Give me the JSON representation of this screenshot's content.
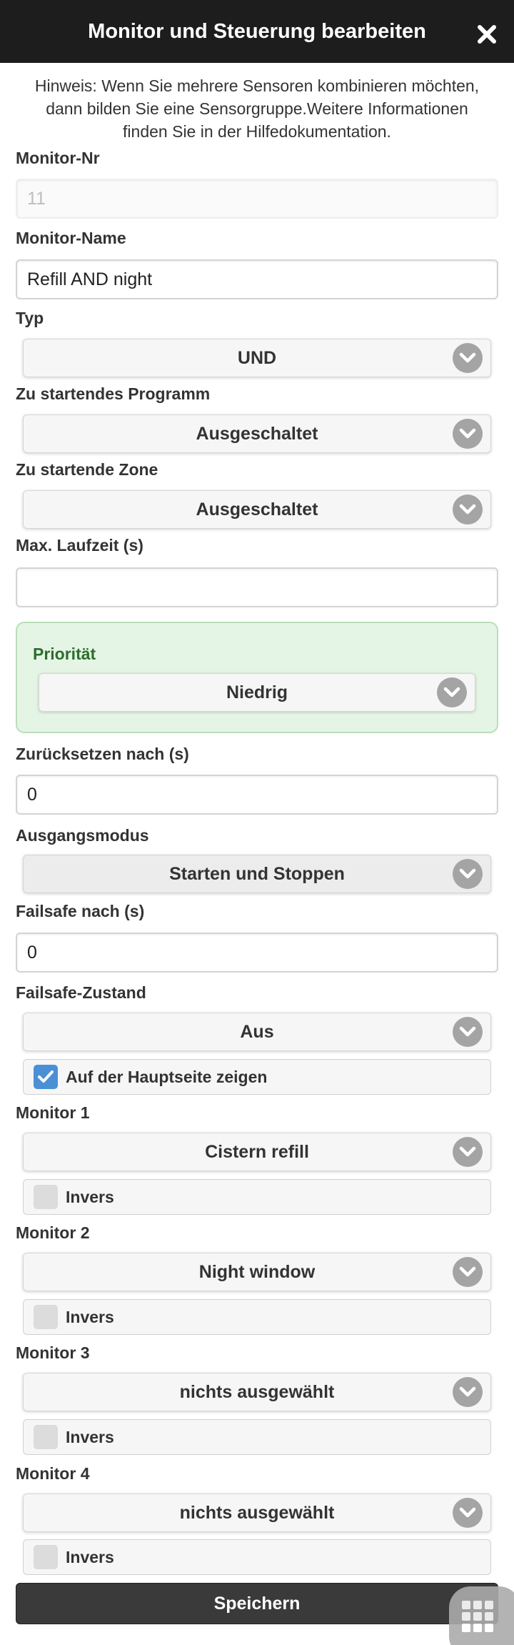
{
  "dialog": {
    "title": "Monitor und Steuerung bearbeiten",
    "hint": "Hinweis: Wenn Sie mehrere Sensoren kombinieren möchten, dann bilden Sie eine Sensorgruppe.Weitere Informationen finden Sie in der Hilfedokumentation."
  },
  "fields": {
    "monitor_nr": {
      "label": "Monitor-Nr",
      "value": "11"
    },
    "monitor_name": {
      "label": "Monitor-Name",
      "value": "Refill AND night"
    },
    "typ": {
      "label": "Typ",
      "value": "UND"
    },
    "program": {
      "label": "Zu startendes Programm",
      "value": "Ausgeschaltet"
    },
    "zone": {
      "label": "Zu startende Zone",
      "value": "Ausgeschaltet"
    },
    "max_runtime": {
      "label": "Max. Laufzeit (s)",
      "value": ""
    },
    "priority": {
      "label": "Priorität",
      "value": "Niedrig"
    },
    "reset_after": {
      "label": "Zurücksetzen nach (s)",
      "value": "0"
    },
    "output_mode": {
      "label": "Ausgangsmodus",
      "value": "Starten und Stoppen"
    },
    "failsafe_after": {
      "label": "Failsafe nach (s)",
      "value": "0"
    },
    "failsafe_state": {
      "label": "Failsafe-Zustand",
      "value": "Aus"
    },
    "show_main": {
      "label": "Auf der Hauptseite zeigen",
      "checked": true
    }
  },
  "monitors": [
    {
      "label": "Monitor 1",
      "value": "Cistern refill",
      "invers_label": "Invers",
      "invers": false
    },
    {
      "label": "Monitor 2",
      "value": "Night window",
      "invers_label": "Invers",
      "invers": false
    },
    {
      "label": "Monitor 3",
      "value": "nichts ausgewählt",
      "invers_label": "Invers",
      "invers": false
    },
    {
      "label": "Monitor 4",
      "value": "nichts ausgewählt",
      "invers_label": "Invers",
      "invers": false
    }
  ],
  "actions": {
    "save_label": "Speichern"
  },
  "icons": {
    "close": "close-icon",
    "chevron": "chevron-down-icon",
    "check": "check-icon",
    "grid": "grid-icon"
  },
  "colors": {
    "header_bg": "#1d1d1d",
    "priority_bg": "#e5f5e5",
    "priority_label": "#2c6d2c",
    "checkbox_checked": "#4a90d6",
    "save_bg": "#3a3a3a"
  }
}
